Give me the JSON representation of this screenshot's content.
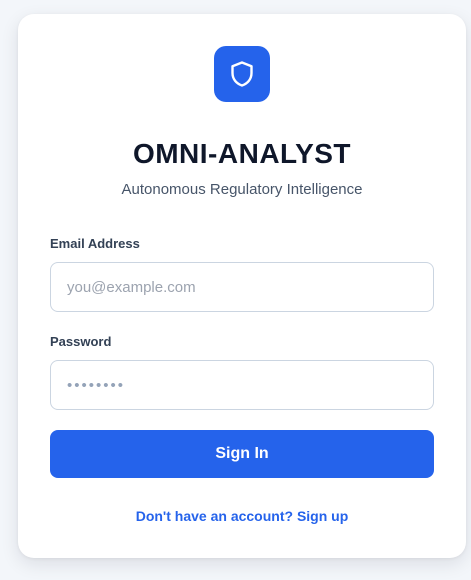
{
  "brand": {
    "title": "OMNI-ANALYST",
    "subtitle": "Autonomous Regulatory Intelligence",
    "logo_icon": "shield-icon",
    "accent_color": "#2563eb"
  },
  "form": {
    "email": {
      "label": "Email Address",
      "placeholder": "you@example.com",
      "value": ""
    },
    "password": {
      "label": "Password",
      "placeholder": "••••••••",
      "value": ""
    },
    "submit_label": "Sign In",
    "signup_link": "Don't have an account? Sign up"
  }
}
